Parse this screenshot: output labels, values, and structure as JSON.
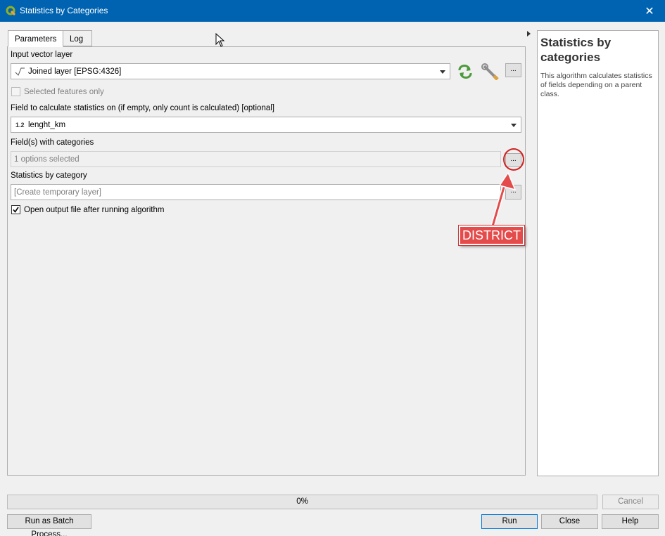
{
  "window": {
    "title": "Statistics by Categories",
    "close_glyph": "✕"
  },
  "tabs": [
    {
      "label": "Parameters"
    },
    {
      "label": "Log"
    }
  ],
  "params": {
    "input_layer_label": "Input vector layer",
    "input_layer_value": "Joined layer [EPSG:4326]",
    "selected_only_label": "Selected features only",
    "stats_field_label": "Field to calculate statistics on (if empty, only count is calculated) [optional]",
    "stats_field_type": "1.2",
    "stats_field_value": "lenght_km",
    "categories_label": "Field(s) with categories",
    "categories_value": "1 options selected",
    "output_label": "Statistics by category",
    "output_value": "[Create temporary layer]",
    "open_output_label": "Open output file after running algorithm",
    "ellipsis": "..."
  },
  "help": {
    "title": "Statistics by categories",
    "text": "This algorithm calculates statistics of fields depending on a parent class."
  },
  "annotation": {
    "text": "DISTRICT"
  },
  "bottom": {
    "progress": "0%",
    "cancel": "Cancel",
    "batch": "Run as Batch Process...",
    "run": "Run",
    "close": "Close",
    "help": "Help"
  }
}
